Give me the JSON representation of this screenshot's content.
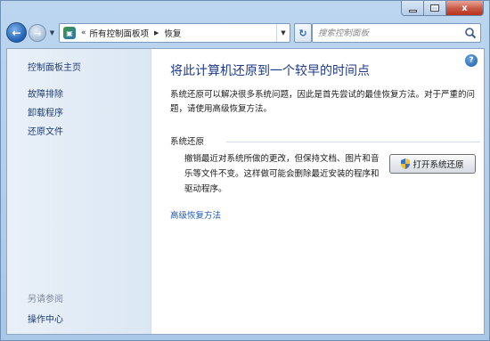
{
  "window": {
    "controls": {
      "minimize_icon": "minimize-icon",
      "maximize_icon": "maximize-icon",
      "close_label": "x"
    }
  },
  "nav": {
    "back_icon": "back-arrow-icon",
    "forward_icon": "forward-arrow-icon",
    "breadcrumb": {
      "overflow": "«",
      "items": [
        "所有控制面板项",
        "恢复"
      ]
    },
    "search_placeholder": "搜索控制面板"
  },
  "sidebar": {
    "home": "控制面板主页",
    "items": [
      "故障排除",
      "卸载程序",
      "还原文件"
    ],
    "see_also_heading": "另请参阅",
    "see_also_items": [
      "操作中心"
    ]
  },
  "main": {
    "title": "将此计算机还原到一个较早的时间点",
    "description": "系统还原可以解决很多系统问题，因此是首先尝试的最佳恢复方法。对于严重的问题，请使用高级恢复方法。",
    "section": {
      "title": "系统还原",
      "description": "撤销最近对系统所做的更改，但保持文档、图片和音乐等文件不变。这样做可能会删除最近安装的程序和驱动程序。",
      "button_label": "打开系统还原"
    },
    "advanced_link": "高级恢复方法",
    "help_label": "?"
  },
  "colors": {
    "link": "#1f3d73",
    "title": "#1e3a8a",
    "frame": "#bcd6f0"
  }
}
